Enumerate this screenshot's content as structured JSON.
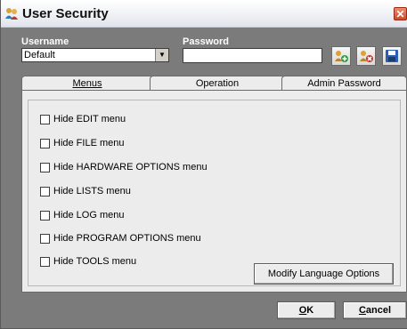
{
  "window": {
    "title": "User Security",
    "close_glyph": "✕"
  },
  "fields": {
    "username_label": "Username",
    "username_value": "Default",
    "password_label": "Password",
    "password_value": ""
  },
  "toolbar": {
    "add_user_icon": "add-user-icon",
    "delete_user_icon": "delete-user-icon",
    "save_icon": "save-icon"
  },
  "tabs": [
    {
      "label": "Menus",
      "active": true
    },
    {
      "label": "Operation",
      "active": false
    },
    {
      "label": "Admin Password",
      "active": false
    }
  ],
  "menus": {
    "options": [
      {
        "label": "Hide EDIT menu",
        "checked": false
      },
      {
        "label": "Hide FILE menu",
        "checked": false
      },
      {
        "label": "Hide HARDWARE OPTIONS menu",
        "checked": false
      },
      {
        "label": "Hide LISTS menu",
        "checked": false
      },
      {
        "label": "Hide LOG menu",
        "checked": false
      },
      {
        "label": "Hide PROGRAM OPTIONS menu",
        "checked": false
      },
      {
        "label": "Hide TOOLS menu",
        "checked": false
      }
    ],
    "modify_language_label": "Modify Language Options"
  },
  "footer": {
    "ok_mnemonic": "O",
    "ok_rest": "K",
    "cancel_mnemonic": "C",
    "cancel_rest": "ancel"
  },
  "colors": {
    "window_bg": "#7b7b7b",
    "panel_bg": "#ececec",
    "close": "#cf4a2a"
  }
}
